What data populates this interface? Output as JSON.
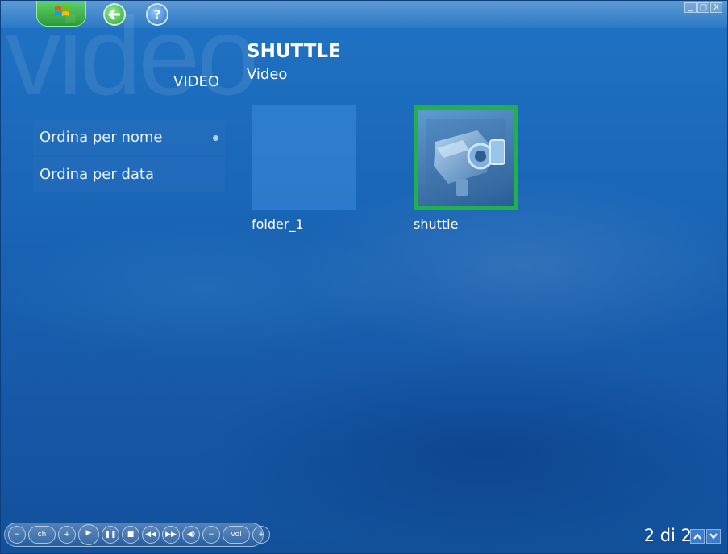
{
  "app": {
    "watermark": "video",
    "section_label": "VIDEO",
    "title": "SHUTTLE",
    "subtitle": "Video"
  },
  "topbar": {
    "start_icon": "windows-logo-icon",
    "back_icon": "back-arrow-icon",
    "help_icon": "help-icon",
    "help_glyph": "?",
    "window_controls": [
      "_",
      "□",
      "X"
    ]
  },
  "sort_menu": {
    "items": [
      {
        "label": "Ordina per nome",
        "selected": true
      },
      {
        "label": "Ordina per data",
        "selected": false
      }
    ]
  },
  "gallery": {
    "items": [
      {
        "label": "folder_1",
        "type": "folder",
        "selected": false
      },
      {
        "label": "shuttle",
        "type": "video",
        "icon": "camcorder-icon",
        "selected": true
      }
    ],
    "selected_border_color": "#21b14a"
  },
  "transport": {
    "ch_label": "ch",
    "vol_label": "vol"
  },
  "pager": {
    "text": "2 di 2"
  }
}
